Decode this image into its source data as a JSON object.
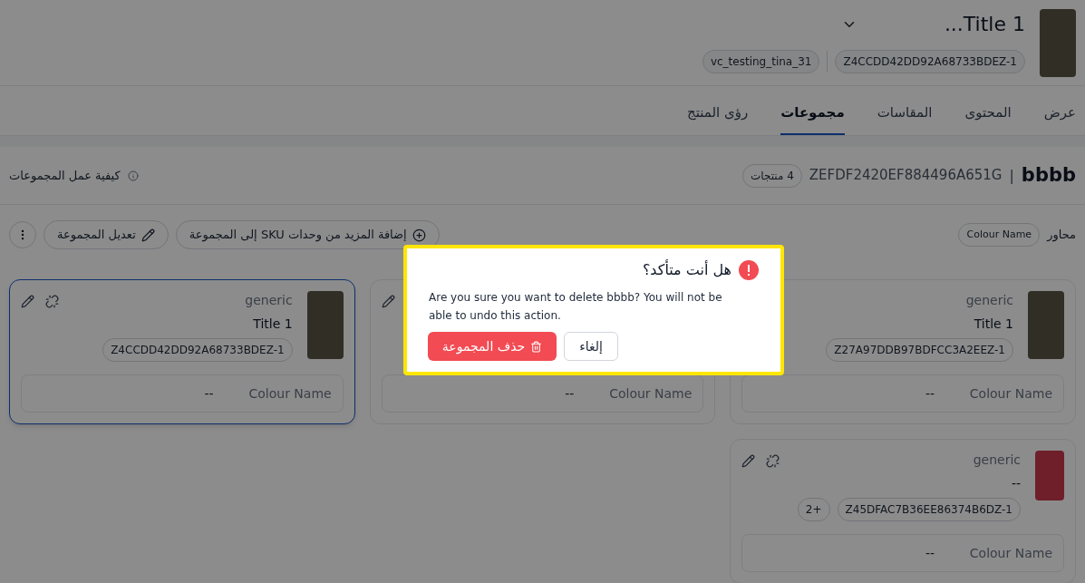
{
  "header": {
    "title": "Title 1...",
    "sku_chip": "Z4CCDD42DD92A68733BDEZ-1",
    "vendor_chip": "vc_testing_tina_31"
  },
  "tabs": [
    {
      "label": "عرض",
      "selected": false
    },
    {
      "label": "المحتوى",
      "selected": false
    },
    {
      "label": "المقاسات",
      "selected": false
    },
    {
      "label": "مجموعات",
      "selected": true
    },
    {
      "label": "رؤى المنتج",
      "selected": false
    }
  ],
  "group": {
    "name": "bbbb",
    "separator": "|",
    "code": "ZEFDF2420EF884496A651G",
    "count_badge": "4 منتجات",
    "help_link": "كيفية عمل المجموعات"
  },
  "axes": {
    "label": "محاور",
    "chips": [
      "Colour Name"
    ]
  },
  "actions": [
    {
      "kind": "add",
      "label": "إضافة المزيد من وحدات SKU إلى المجموعة"
    },
    {
      "kind": "edit",
      "label": "تعديل المجموعة"
    },
    {
      "kind": "more"
    }
  ],
  "cards": [
    {
      "selected": false,
      "kind": "jacket",
      "brand": "generic",
      "title": "Title 1",
      "sku": "Z27A97DDB97BDFCC3A2EEZ-1",
      "attributes": [
        {
          "name": "Colour Name",
          "value": "--"
        }
      ]
    },
    {
      "selected": false,
      "kind": "covered",
      "attributes": [
        {
          "name": "Colour Name",
          "value": "--"
        }
      ]
    },
    {
      "selected": true,
      "kind": "jacket",
      "brand": "generic",
      "title": "Title 1",
      "sku": "Z4CCDD42DD92A68733BDEZ-1",
      "attributes": [
        {
          "name": "Colour Name",
          "value": "--"
        }
      ]
    },
    {
      "selected": false,
      "kind": "wardrobe",
      "brand": "generic",
      "title": "--",
      "sku": "Z45DFAC7B36EE86374B6DZ-1",
      "extra_count": "+2",
      "attributes": [
        {
          "name": "Colour Name",
          "value": "--"
        }
      ]
    }
  ],
  "dialog": {
    "title": "هل أنت متأكد؟",
    "message": "Are you sure you want to delete bbbb? You will not be able to undo this action.",
    "buttons": [
      {
        "kind": "cancel",
        "label": "إلغاء"
      },
      {
        "kind": "danger",
        "label": "حذف المجموعة"
      }
    ]
  }
}
